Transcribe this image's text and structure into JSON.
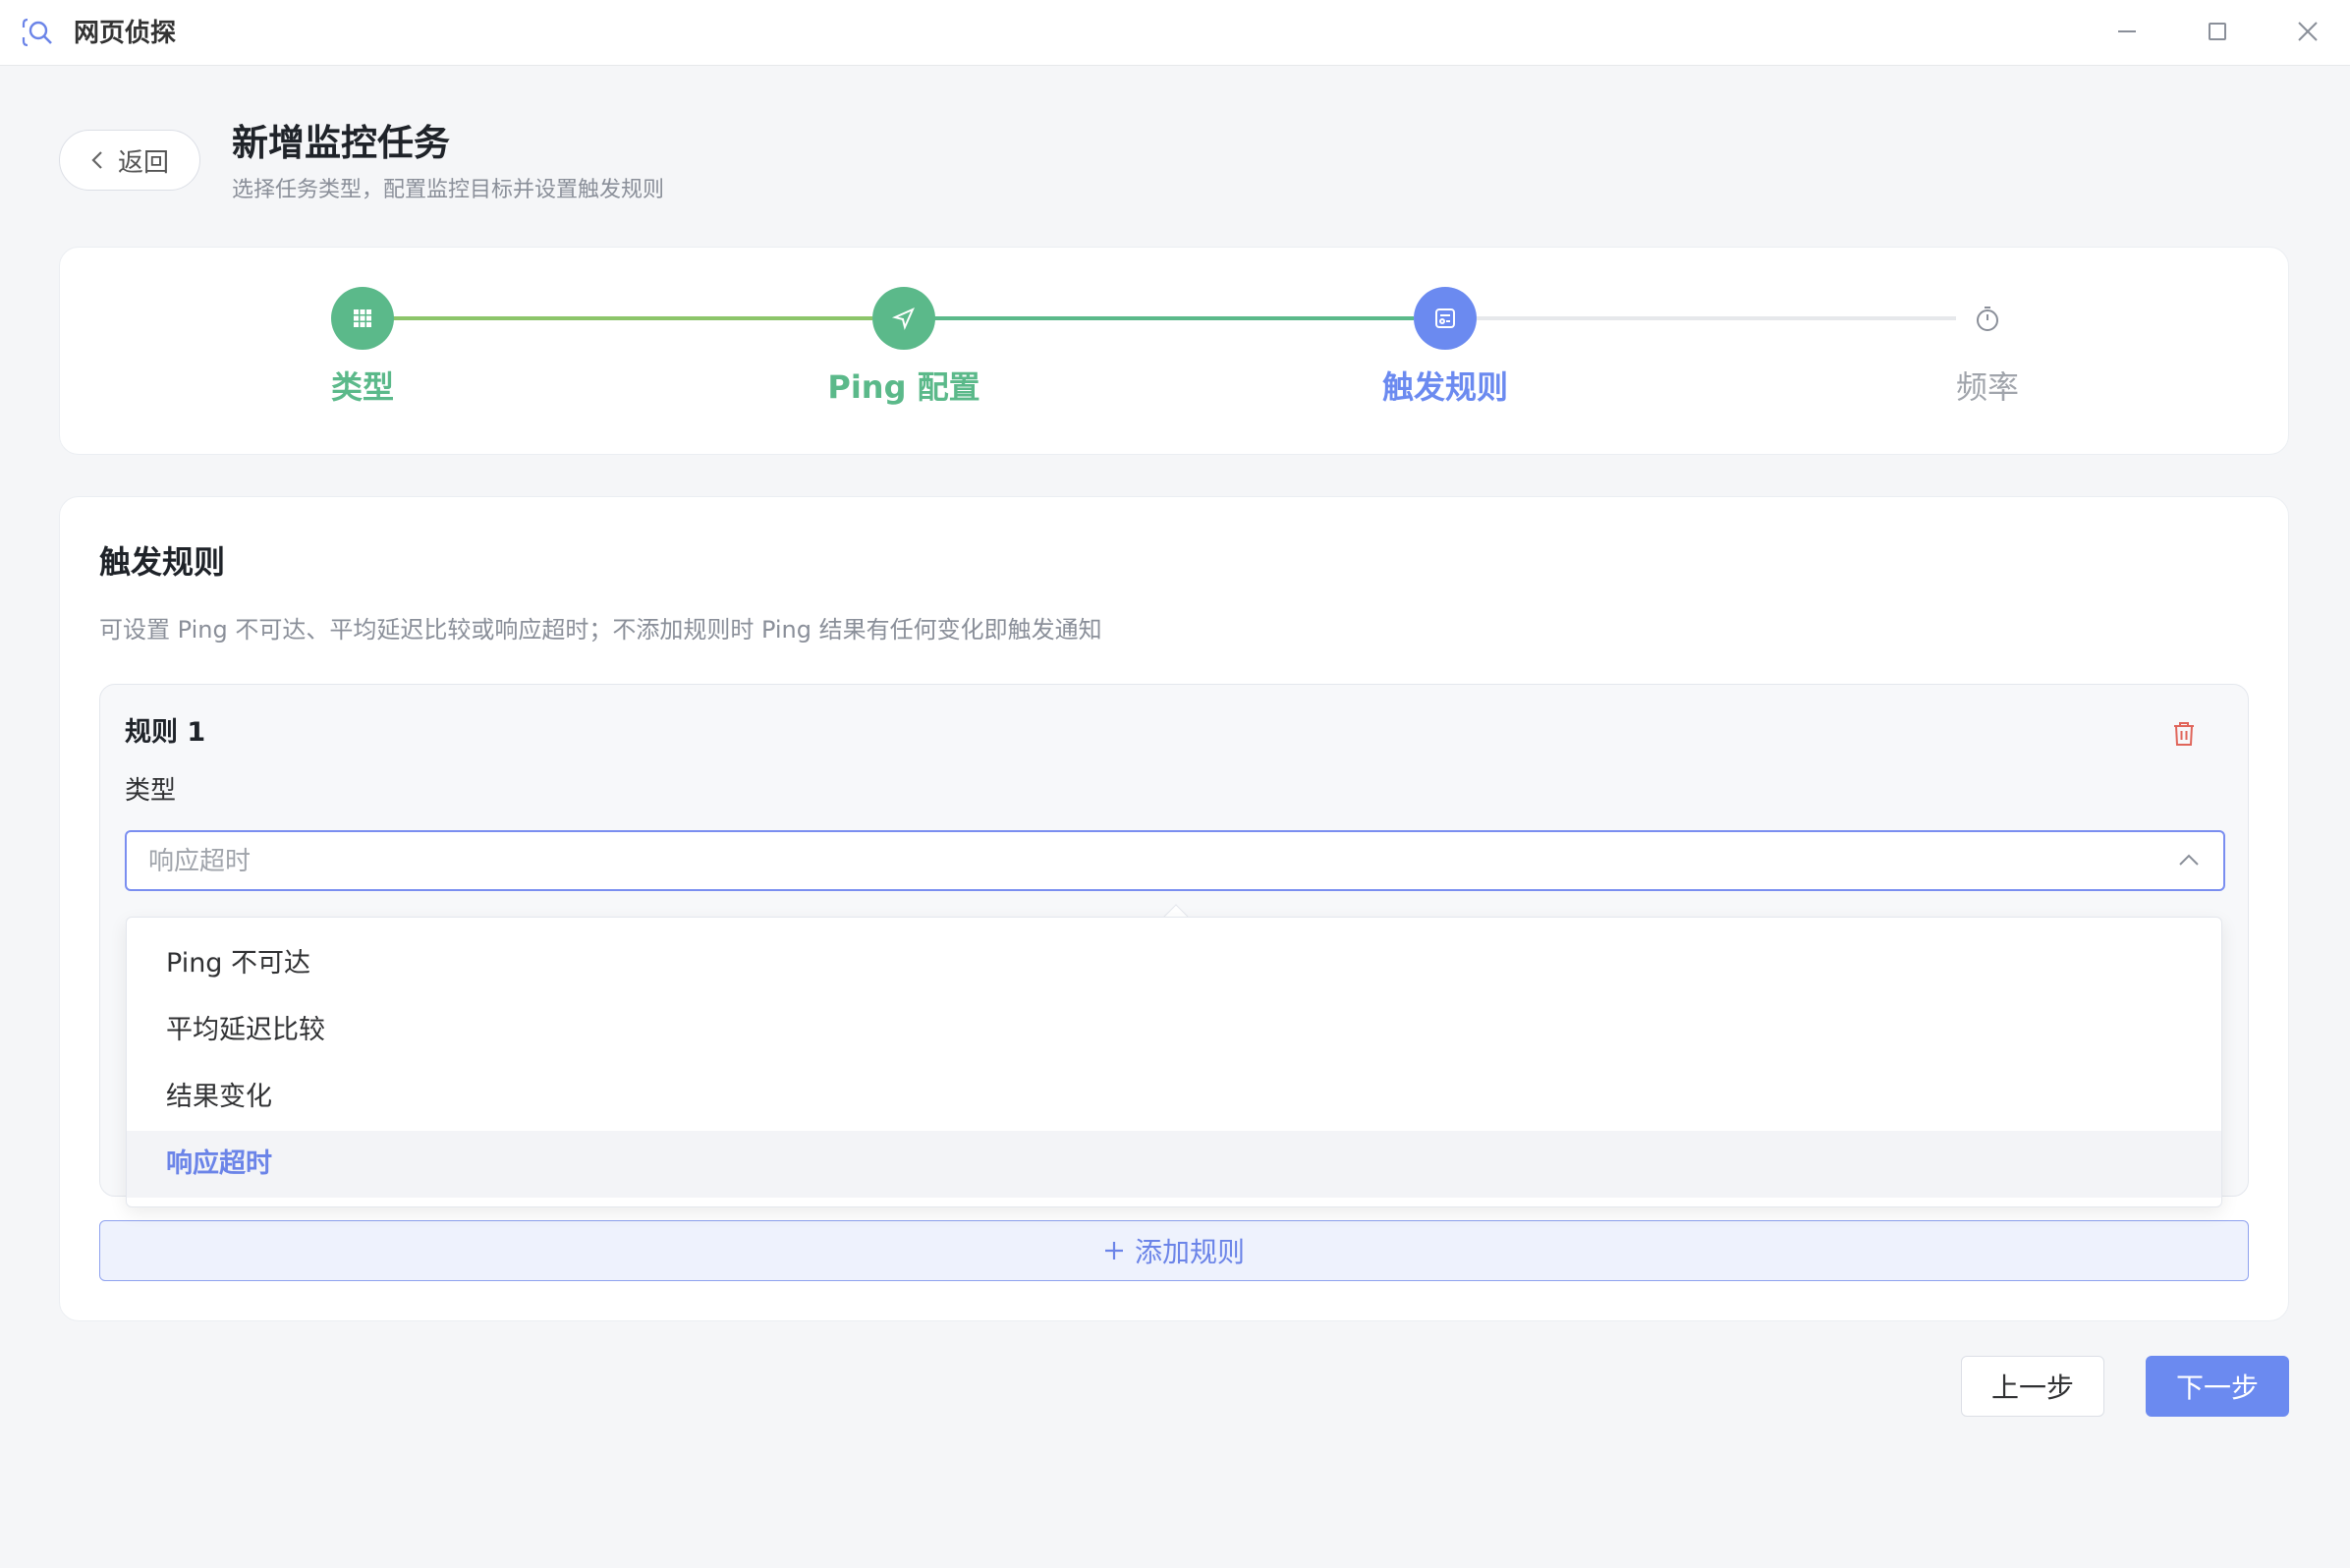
{
  "window": {
    "title": "网页侦探",
    "icon": "app-logo-icon",
    "controls": [
      "minimize-icon",
      "maximize-icon",
      "close-icon"
    ]
  },
  "header": {
    "back_label": "返回",
    "title": "新增监控任务",
    "subtitle": "选择任务类型，配置监控目标并设置触发规则"
  },
  "steps": [
    {
      "label": "类型",
      "icon": "grid-icon",
      "state": "done",
      "color": "#5bb98a"
    },
    {
      "label": "Ping 配置",
      "icon": "send-icon",
      "state": "done",
      "color": "#5bb98a"
    },
    {
      "label": "触发规则",
      "icon": "rules-icon",
      "state": "active",
      "color": "#6b8af0"
    },
    {
      "label": "频率",
      "icon": "timer-icon",
      "state": "pending",
      "color": "#a0a4ab"
    }
  ],
  "rules_section": {
    "title": "触发规则",
    "description": "可设置 Ping 不可达、平均延迟比较或响应超时；不添加规则时 Ping 结果有任何变化即触发通知",
    "rule": {
      "title": "规则 1",
      "type_label": "类型",
      "selected_value": "响应超时"
    },
    "dropdown_options": [
      "Ping 不可达",
      "平均延迟比较",
      "结果变化",
      "响应超时"
    ],
    "add_rule_label": "添加规则"
  },
  "footer": {
    "prev_label": "上一步",
    "next_label": "下一步"
  },
  "colors": {
    "accent": "#6b8af0",
    "success": "#5bb98a",
    "danger": "#e0655a"
  }
}
